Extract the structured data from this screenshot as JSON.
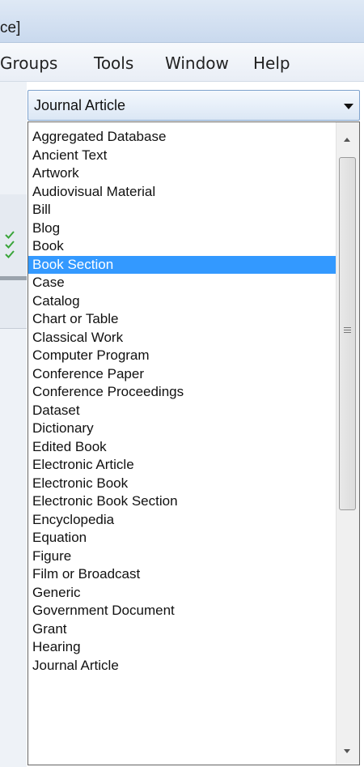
{
  "window": {
    "title_fragment": "ce]"
  },
  "menubar": {
    "items": [
      "Groups",
      "Tools",
      "Window",
      "Help"
    ]
  },
  "reference_type": {
    "selected_value": "Journal Article",
    "options": [
      "Aggregated Database",
      "Ancient Text",
      "Artwork",
      "Audiovisual Material",
      "Bill",
      "Blog",
      "Book",
      "Book Section",
      "Case",
      "Catalog",
      "Chart or Table",
      "Classical Work",
      "Computer Program",
      "Conference Paper",
      "Conference Proceedings",
      "Dataset",
      "Dictionary",
      "Edited Book",
      "Electronic Article",
      "Electronic Book",
      "Electronic Book Section",
      "Encyclopedia",
      "Equation",
      "Figure",
      "Film or Broadcast",
      "Generic",
      "Government Document",
      "Grant",
      "Hearing",
      "Journal Article"
    ],
    "highlighted_option": "Book Section"
  },
  "icons": {
    "check_icon": "check-icon",
    "dropdown_arrow": "chevron-down-icon",
    "scroll_up": "scroll-up-icon",
    "scroll_down": "scroll-down-icon",
    "scroll_grip": "grip-icon"
  },
  "colors": {
    "highlight": "#3399ff",
    "check": "#3aa53a"
  }
}
